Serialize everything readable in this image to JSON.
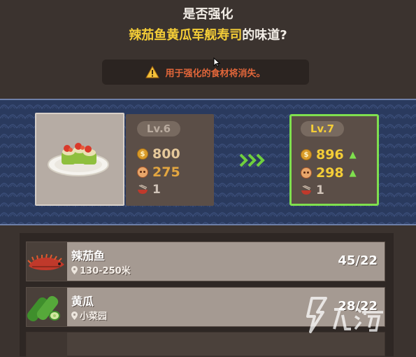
{
  "header": {
    "question": "是否强化",
    "dish_name": "辣茄鱼黄瓜军舰寿司",
    "suffix": "的味道?"
  },
  "warning": {
    "text": "用于强化的食材将消失。",
    "icon": "warning-triangle-icon",
    "color": "#e2663a"
  },
  "current": {
    "level": "Lv.6",
    "price": "800",
    "fame": "275",
    "count": "1"
  },
  "upgraded": {
    "level": "Lv.7",
    "price": "896",
    "fame": "298",
    "count": "1",
    "highlight_color": "#7fe04e"
  },
  "ingredients": [
    {
      "name": "辣茄鱼",
      "location": "130-250米",
      "count": "45/22",
      "icon": "chili-fish-icon"
    },
    {
      "name": "黄瓜",
      "location": "小菜园",
      "count": "28/22",
      "icon": "cucumber-icon"
    }
  ],
  "colors": {
    "accent_yellow": "#f4cd37",
    "band_blue": "#2a3a5e",
    "panel_brown": "#5b4e47"
  }
}
